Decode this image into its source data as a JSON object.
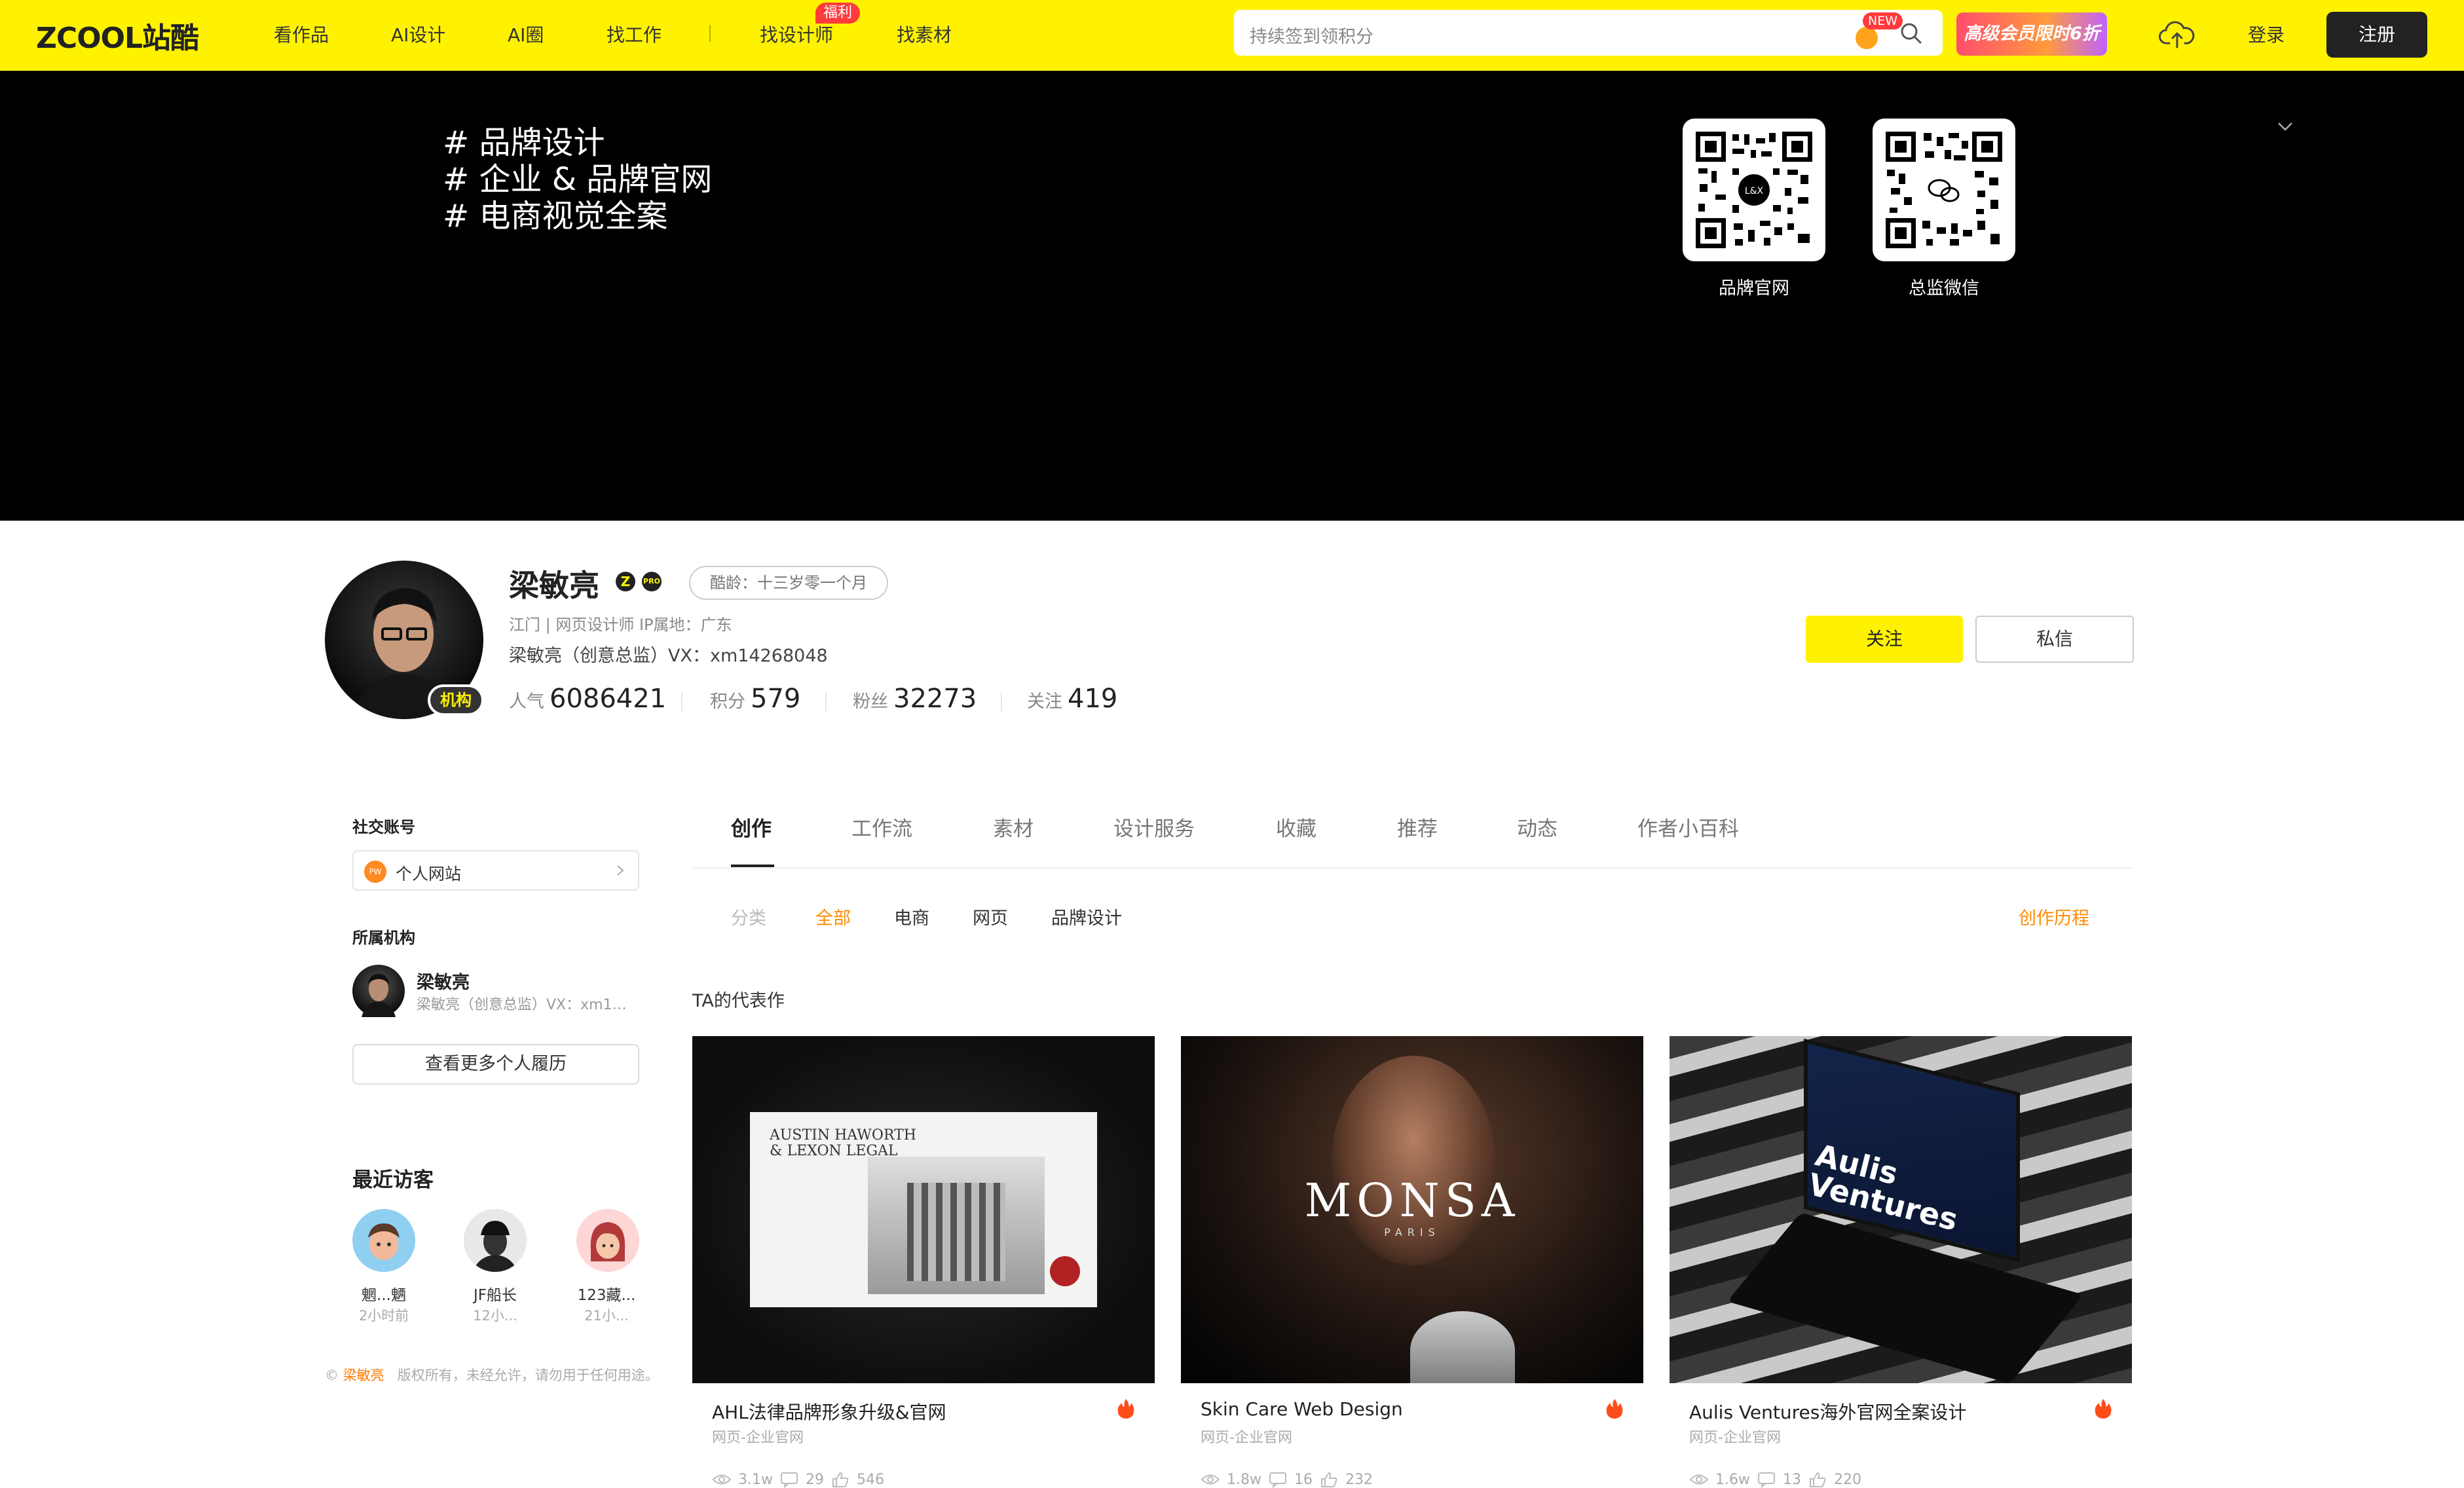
{
  "nav": {
    "logo": "ZCOOL站酷",
    "items": [
      "看作品",
      "AI设计",
      "AI圈",
      "找工作",
      "找设计师",
      "找素材"
    ],
    "fuli_badge": "福利",
    "search_placeholder": "持续签到领积分",
    "new_badge": "NEW",
    "vip_label": "高级会员限时6折",
    "login": "登录",
    "register": "注册"
  },
  "banner": {
    "tags": [
      "# 品牌设计",
      "# 企业 & 品牌官网",
      "# 电商视觉全案"
    ],
    "qr_labels": [
      "品牌官网",
      "总监微信"
    ],
    "qr_logo_text": "L&X"
  },
  "profile": {
    "name": "梁敏亮",
    "org_badge": "机构",
    "z_badge": "Z",
    "pro_badge": "PRO",
    "age": "酷龄：十三岁零一个月",
    "meta": "江门 | 网页设计师      IP属地：广东",
    "bio": "梁敏亮（创意总监）VX：xm14268048",
    "stats": [
      {
        "label": "人气",
        "value": "6086421"
      },
      {
        "label": "积分",
        "value": "579"
      },
      {
        "label": "粉丝",
        "value": "32273"
      },
      {
        "label": "关注",
        "value": "419"
      }
    ],
    "follow": "关注",
    "message": "私信"
  },
  "sidebar": {
    "social_heading": "社交账号",
    "site_icon": "PW",
    "site_label": "个人网站",
    "org_heading": "所属机构",
    "org_name": "梁敏亮",
    "org_desc": "梁敏亮（创意总监）VX：xm1…",
    "resume_btn": "查看更多个人履历",
    "visitors_heading": "最近访客",
    "visitors": [
      {
        "name": "魍...魉",
        "time": "2小时前"
      },
      {
        "name": "JF船长",
        "time": "12小..."
      },
      {
        "name": "123藏...",
        "time": "21小..."
      }
    ],
    "copyright_owner": "梁敏亮",
    "copyright_text": "版权所有，未经允许，请勿用于任何用途。",
    "copyright_mark": "©"
  },
  "tabs": [
    "创作",
    "工作流",
    "素材",
    "设计服务",
    "收藏",
    "推荐",
    "动态",
    "作者小百科"
  ],
  "filters": {
    "label": "分类",
    "items": [
      "全部",
      "电商",
      "网页",
      "品牌设计"
    ],
    "history": "创作历程"
  },
  "representative_heading": "TA的代表作",
  "cards": [
    {
      "title": "AHL法律品牌形象升级&官网",
      "sub": "网页-企业官网",
      "views": "3.1w",
      "comments": "29",
      "likes": "546",
      "img_text1": "AUSTIN HAWORTH",
      "img_text2": "& LEXON LEGAL"
    },
    {
      "title": "Skin Care Web Design",
      "sub": "网页-企业官网",
      "views": "1.8w",
      "comments": "16",
      "likes": "232",
      "img_text1": "MONSA",
      "img_text2": "PARIS"
    },
    {
      "title": "Aulis Ventures海外官网全案设计",
      "sub": "网页-企业官网",
      "views": "1.6w",
      "comments": "13",
      "likes": "220",
      "img_text1": "Aulis",
      "img_text2": "Ventures"
    }
  ],
  "colors": {
    "brand_yellow": "#fff200",
    "accent_orange": "#ff8a00",
    "dark": "#222222"
  }
}
